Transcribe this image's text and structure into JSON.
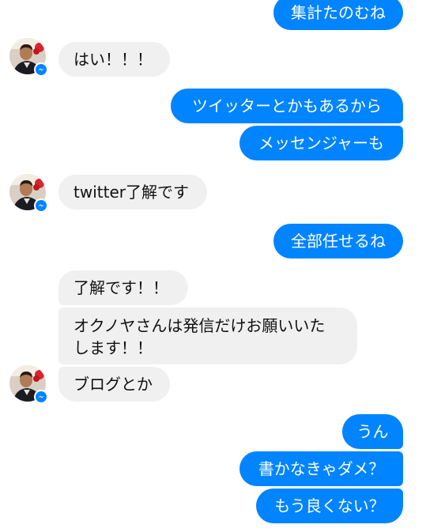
{
  "messages": [
    {
      "side": "out",
      "text": "集計たのむね"
    },
    {
      "side": "in",
      "text": "はい！！！"
    },
    {
      "side": "out",
      "text": "ツイッターとかもあるから"
    },
    {
      "side": "out",
      "text": "メッセンジャーも"
    },
    {
      "side": "in",
      "text": "twitter了解です"
    },
    {
      "side": "out",
      "text": "全部任せるね"
    },
    {
      "side": "in",
      "text": "了解です！！"
    },
    {
      "side": "in",
      "line1": "オクノヤさんは発信だけお願いいた",
      "line2": "します！！"
    },
    {
      "side": "in",
      "text": "ブログとか"
    },
    {
      "side": "out",
      "text": "うん"
    },
    {
      "side": "out",
      "text": "書かなきゃダメ？"
    },
    {
      "side": "out",
      "text": "もう良くない？"
    }
  ],
  "colors": {
    "outgoing_bubble": "#0084ff",
    "incoming_bubble": "#f1f0f0",
    "outgoing_text": "#ffffff",
    "incoming_text": "#111111",
    "messenger_badge": "#0084ff"
  },
  "icons": {
    "avatar": "contact-avatar",
    "badge": "messenger-badge-icon"
  }
}
